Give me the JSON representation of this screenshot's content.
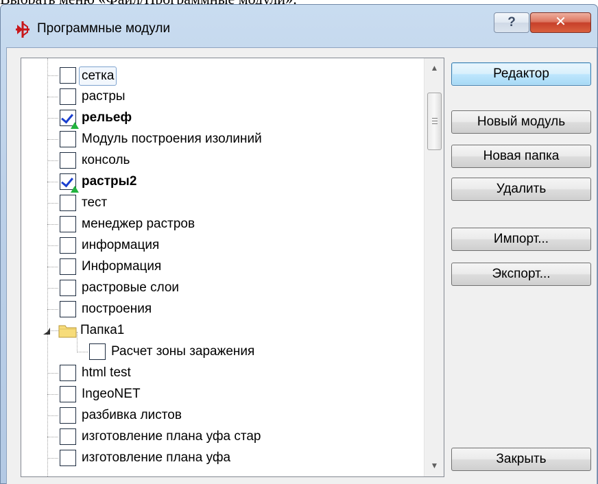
{
  "caption": "Выбрать меню «Файл/Программные модули»:",
  "window": {
    "title": "Программные модули",
    "help_label": "?",
    "close_label": "✕",
    "accent_close": "#c7402a"
  },
  "tree": {
    "items": [
      {
        "label": "сетка",
        "checked": false,
        "bold": false,
        "selected": true
      },
      {
        "label": "растры",
        "checked": false,
        "bold": false
      },
      {
        "label": "рельеф",
        "checked": true,
        "bold": true
      },
      {
        "label": "Модуль построения изолиний",
        "checked": false,
        "bold": false
      },
      {
        "label": "консоль",
        "checked": false,
        "bold": false
      },
      {
        "label": "растры2",
        "checked": true,
        "bold": true
      },
      {
        "label": "тест",
        "checked": false,
        "bold": false
      },
      {
        "label": "менеджер растров",
        "checked": false,
        "bold": false
      },
      {
        "label": "информация",
        "checked": false,
        "bold": false
      },
      {
        "label": "Информация",
        "checked": false,
        "bold": false
      },
      {
        "label": "растровые слои",
        "checked": false,
        "bold": false
      },
      {
        "label": "построения",
        "checked": false,
        "bold": false
      },
      {
        "label": "Папка1",
        "folder": true,
        "expanded": true
      },
      {
        "label": "Расчет зоны заражения",
        "checked": false,
        "bold": false,
        "child": true
      },
      {
        "label": "html test",
        "checked": false,
        "bold": false
      },
      {
        "label": "IngeoNET",
        "checked": false,
        "bold": false
      },
      {
        "label": "разбивка листов",
        "checked": false,
        "bold": false
      },
      {
        "label": "изготовление плана уфа стар",
        "checked": false,
        "bold": false
      },
      {
        "label": "изготовление плана уфа",
        "checked": false,
        "bold": false
      }
    ]
  },
  "buttons": {
    "editor": "Редактор",
    "new_module": "Новый модуль",
    "new_folder": "Новая папка",
    "delete": "Удалить",
    "import": "Импорт...",
    "export": "Экспорт...",
    "close": "Закрыть"
  }
}
